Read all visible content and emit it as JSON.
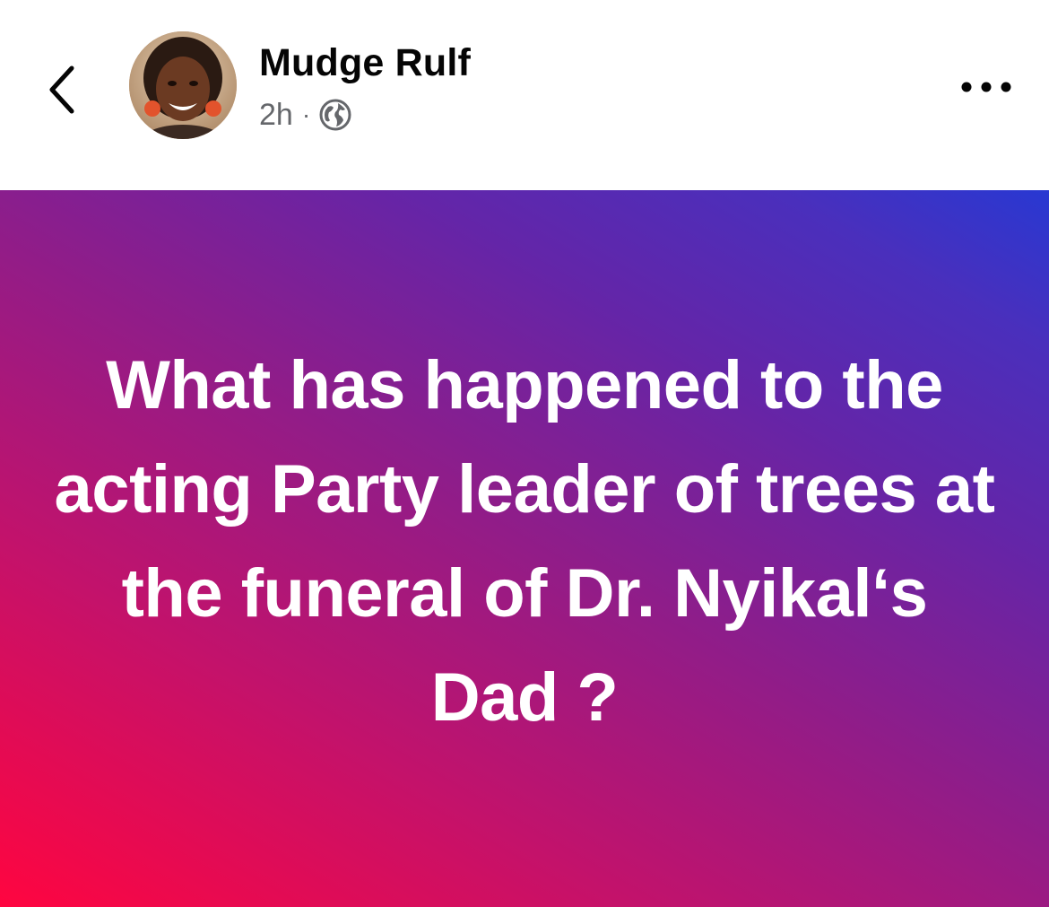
{
  "post": {
    "author_name": "Mudge Rulf",
    "time_ago": "2h",
    "separator": "·",
    "audience_icon": "globe-icon",
    "text": "What has happened to the acting Party leader of trees at the funeral of Dr. Nyikal‘s Dad ?",
    "background_gradient": [
      "#ff0540",
      "#c3126b",
      "#8e1d8a",
      "#6425a8",
      "#2838d2"
    ]
  },
  "header": {
    "back_icon": "chevron-left-icon",
    "more_icon": "more-horizontal-icon"
  },
  "colors": {
    "name_text": "#050505",
    "meta_text": "#65676b",
    "post_text": "#ffffff"
  }
}
